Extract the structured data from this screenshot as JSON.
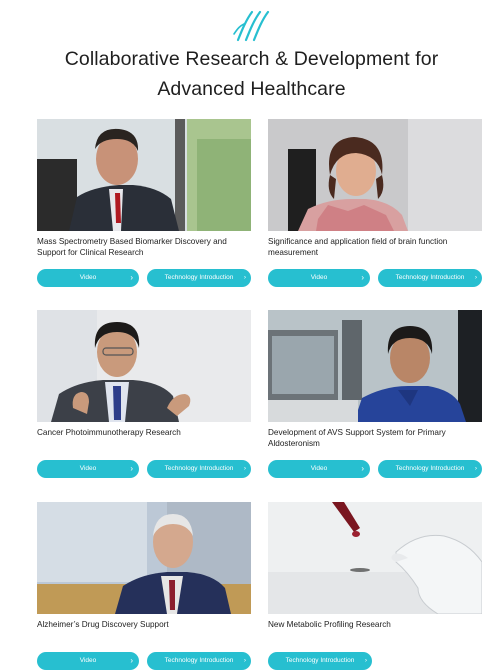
{
  "header": {
    "logo_icon": "stylized-lines-logo",
    "title_line1": "Collaborative Research & Development for",
    "title_line2": "Advanced Healthcare"
  },
  "colors": {
    "accent": "#27bfd0"
  },
  "cards": [
    {
      "caption": "Mass Spectrometry Based Biomarker Discovery and Support for Clinical Research",
      "buttons": {
        "video": "Video",
        "tech": "Technology Introduction"
      }
    },
    {
      "caption": "Significance and application field of brain function measurement",
      "buttons": {
        "video": "Video",
        "tech": "Technology Introduction"
      }
    },
    {
      "caption": "Cancer Photoimmunotherapy Research",
      "buttons": {
        "video": "Video",
        "tech": "Technology Introduction"
      }
    },
    {
      "caption": "Development of AVS Support System for Primary Aldosteronism",
      "buttons": {
        "video": "Video",
        "tech": "Technology Introduction"
      }
    },
    {
      "caption": "Alzheimer’s Drug Discovery Support",
      "buttons": {
        "video": "Video",
        "tech": "Technology Introduction"
      }
    },
    {
      "caption": "New Metabolic Profiling Research",
      "buttons": {
        "tech": "Technology Introduction"
      }
    }
  ]
}
